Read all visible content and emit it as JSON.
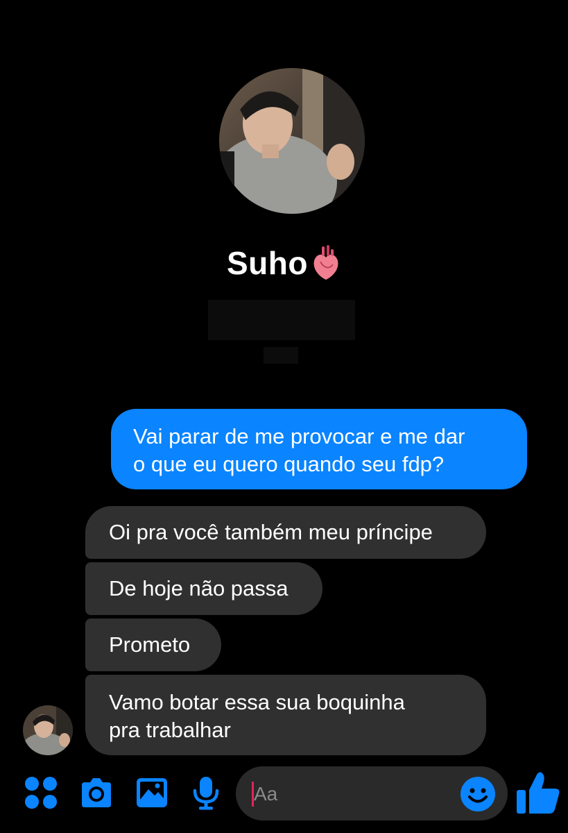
{
  "profile": {
    "name": "Suho",
    "name_icon": "anatomical-heart-icon"
  },
  "messages": [
    {
      "from": "me",
      "lines": [
        "Vai parar de me provocar e me dar",
        "o que eu quero quando seu fdp?"
      ]
    },
    {
      "from": "them",
      "lines": [
        "Oi pra você também meu príncipe"
      ]
    },
    {
      "from": "them",
      "lines": [
        "De hoje não passa"
      ]
    },
    {
      "from": "them",
      "lines": [
        "Prometo"
      ]
    },
    {
      "from": "them",
      "lines": [
        "Vamo botar essa sua boquinha",
        "pra trabalhar"
      ]
    }
  ],
  "composer": {
    "placeholder": "Aa",
    "icons": [
      "apps-icon",
      "camera-icon",
      "gallery-icon",
      "microphone-icon",
      "emoji-icon",
      "thumbs-up-icon"
    ],
    "accent_color": "#0a84ff"
  },
  "colors": {
    "background": "#000000",
    "sent_bubble": "#0a84ff",
    "received_bubble": "#303030"
  }
}
